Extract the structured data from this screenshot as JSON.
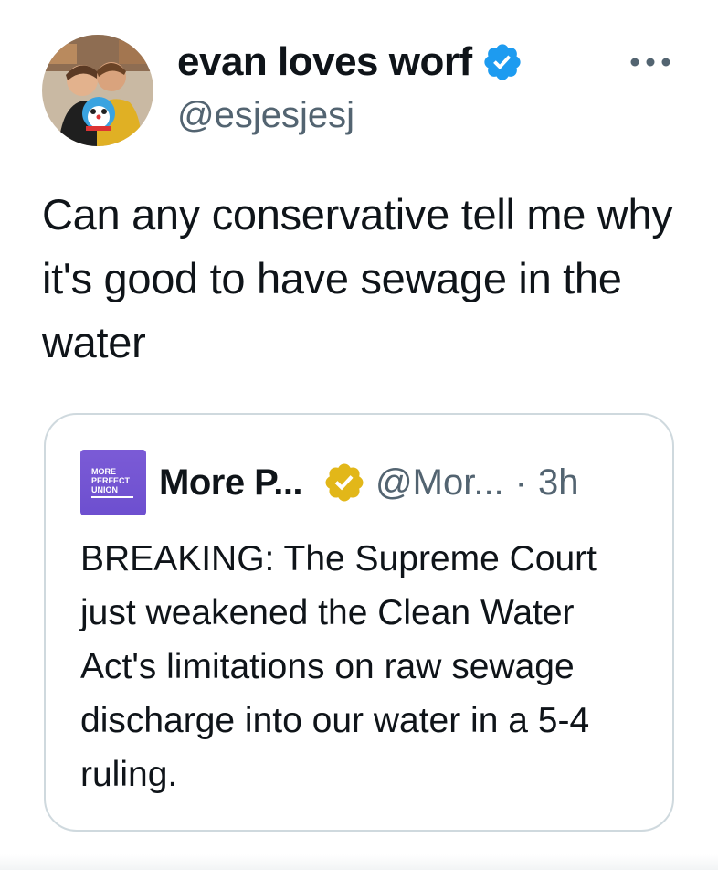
{
  "author": {
    "display_name": "evan loves worf",
    "handle": "@esjesjesj",
    "verified_icon": "verified-badge-blue",
    "avatar_icon": "profile-photo"
  },
  "tweet": {
    "text": "Can any conservative tell me why it's good to have sewage in the water"
  },
  "more_icon": "ellipsis-icon",
  "quoted": {
    "logo_lines": [
      "MORE",
      "PERFECT",
      "UNION"
    ],
    "display_name": "More P...",
    "verified_icon": "verified-badge-gold",
    "handle": "@Mor...",
    "separator": "·",
    "time": "3h",
    "text": "BREAKING: The Supreme Court just weakened the Clean Water Act's limitations on raw sewage discharge into our water in a 5-4 ruling."
  },
  "colors": {
    "text": "#0f1419",
    "secondary": "#536471",
    "verified_blue": "#1d9bf0",
    "verified_gold": "#e2b719",
    "border": "#cfd9de",
    "logo_purple": "#7b5bd6"
  }
}
